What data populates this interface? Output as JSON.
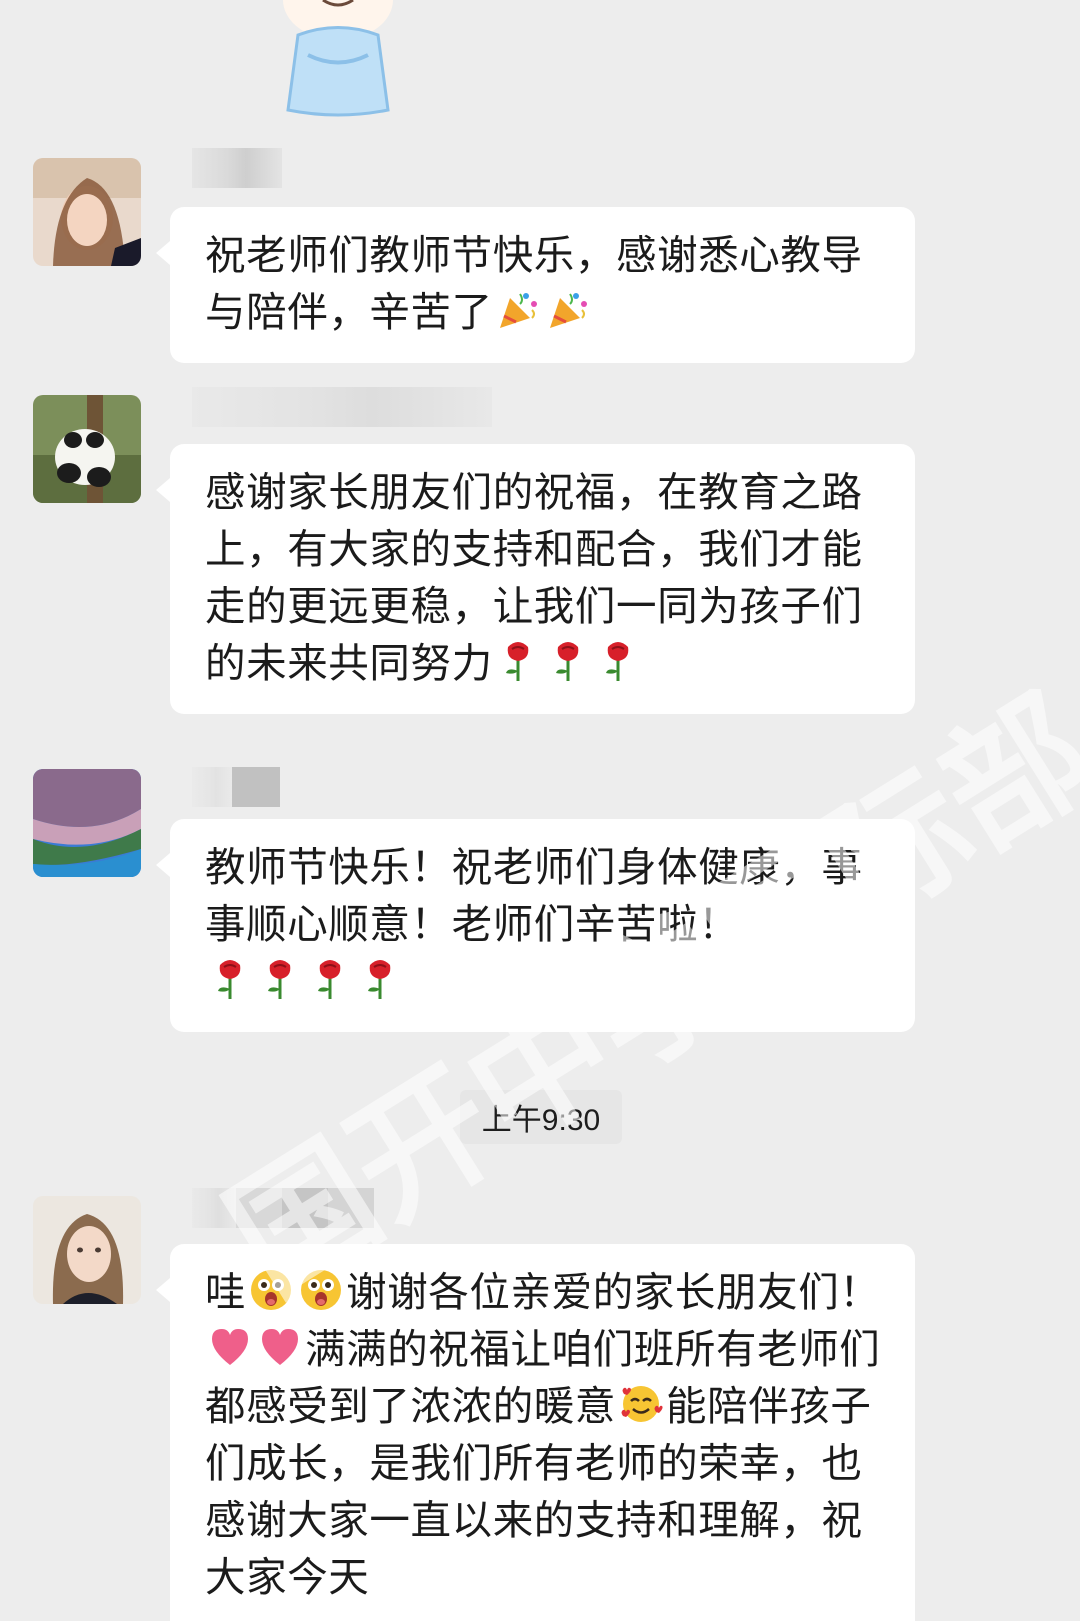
{
  "watermark": "国开中学国际部",
  "messages": [
    {
      "text_parts": [
        "祝老师们教师节快乐，感谢悉心教导与陪伴，辛苦了"
      ],
      "emojis": [
        "party-popper",
        "party-popper"
      ]
    },
    {
      "text_parts": [
        "感谢家长朋友们的祝福，在教育之路上，有大家的支持和配合，我们才能走的更远更稳，让我们一同为孩子们的未来共同努力"
      ],
      "emojis": [
        "rose",
        "rose",
        "rose"
      ]
    },
    {
      "text_parts": [
        "教师节快乐！祝老师们身体健康，事事顺心顺意！老师们辛苦啦！"
      ],
      "emojis": [
        "rose",
        "rose",
        "rose",
        "rose"
      ]
    },
    {
      "text_parts": [
        "哇",
        "谢谢各位亲爱的家长朋友们！",
        "满满的祝福让咱们班所有老师们都感受到了浓浓的暖意",
        "能陪伴孩子们成长，是我们所有老师的荣幸，也感谢大家一直以来的支持和理解，祝大家今天"
      ],
      "emojis": [
        "astonished",
        "heart",
        "smiling-hearts"
      ]
    }
  ],
  "time_separator": "上午9:30"
}
